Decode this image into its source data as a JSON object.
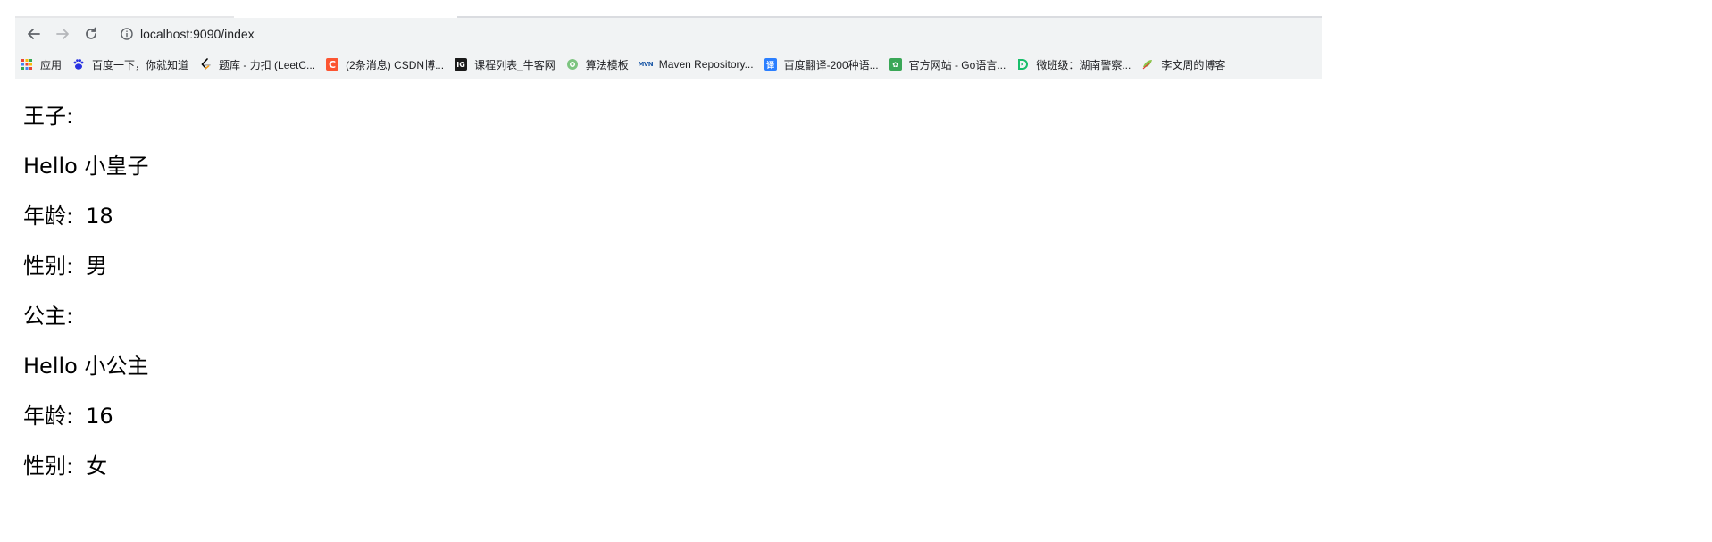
{
  "browser": {
    "url": "localhost:9090/index",
    "bookmarks": [
      {
        "label": "应用",
        "icon": "apps-grid-icon"
      },
      {
        "label": "百度一下，你就知道",
        "icon": "baidu-paw-icon"
      },
      {
        "label": "题库 - 力扣 (LeetC...",
        "icon": "leetcode-icon"
      },
      {
        "label": "(2条消息) CSDN博...",
        "icon": "csdn-icon"
      },
      {
        "label": "课程列表_牛客网",
        "icon": "nowcoder-icon"
      },
      {
        "label": "算法模板",
        "icon": "algorithm-icon"
      },
      {
        "label": "Maven Repository...",
        "icon": "maven-icon"
      },
      {
        "label": "百度翻译-200种语...",
        "icon": "baidu-translate-icon"
      },
      {
        "label": "官方网站 - Go语言...",
        "icon": "go-site-icon"
      },
      {
        "label": "微班级：湖南警察...",
        "icon": "weibanji-icon"
      },
      {
        "label": "李文周的博客",
        "icon": "blog-icon"
      }
    ]
  },
  "page": {
    "prince": {
      "heading": "王子:",
      "greeting": "Hello 小皇子",
      "age_label": "年龄:",
      "age_value": "18",
      "gender_label": "性别:",
      "gender_value": "男"
    },
    "princess": {
      "heading": "公主:",
      "greeting": "Hello 小公主",
      "age_label": "年龄:",
      "age_value": "16",
      "gender_label": "性别:",
      "gender_value": "女"
    }
  },
  "colors": {
    "toolbar_bg": "#f1f3f4",
    "csdn": "#fc5531",
    "translate": "#2b7fff",
    "go_site": "#3aa757",
    "weibanji": "#19be6b",
    "maven": "#1e5aa8"
  }
}
